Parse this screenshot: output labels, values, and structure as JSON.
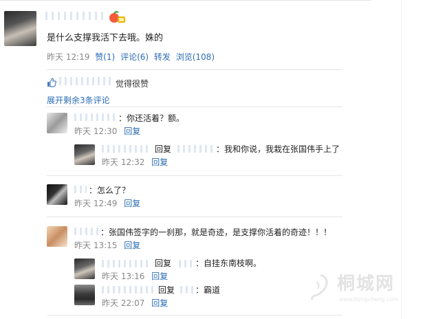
{
  "post": {
    "text": "是什么支撑我活下去哦。姝的",
    "time": "昨天 12:19",
    "actions": [
      "赞(1)",
      "评论(6)",
      "转发",
      "浏览(108)"
    ]
  },
  "likes": {
    "text": "觉得很赞",
    "expand": "展开剩余3条评论"
  },
  "comments": [
    {
      "text": "：你还活着？额。",
      "time": "昨天 12:30",
      "reply": "回复"
    },
    {
      "prefix": "回复",
      "text": "：我和你说，我栽在张国伟手上了",
      "time": "昨天 12:32",
      "reply": "回复"
    },
    {
      "text": "：怎么了？",
      "time": "昨天 12:49",
      "reply": "回复"
    },
    {
      "text": "：张国伟签字的一刹那，就是奇迹，是支撑你活着的奇迹！！！",
      "time": "昨天 13:15",
      "reply": "回复"
    },
    {
      "prefix": "回复",
      "text": "：自挂东南枝啊。",
      "time": "昨天 13:16",
      "reply": "回复"
    },
    {
      "prefix": "回复",
      "text": "：霸道",
      "time": "昨天 22:07",
      "reply": "回复"
    }
  ],
  "watermark": {
    "text": "桐城网",
    "sub": "www.itongcheng.com"
  },
  "icons": {
    "like": "thumbs-up-icon",
    "badge": "peach-icon"
  },
  "colors": {
    "link": "#2b6cb5",
    "meta": "#888888"
  }
}
